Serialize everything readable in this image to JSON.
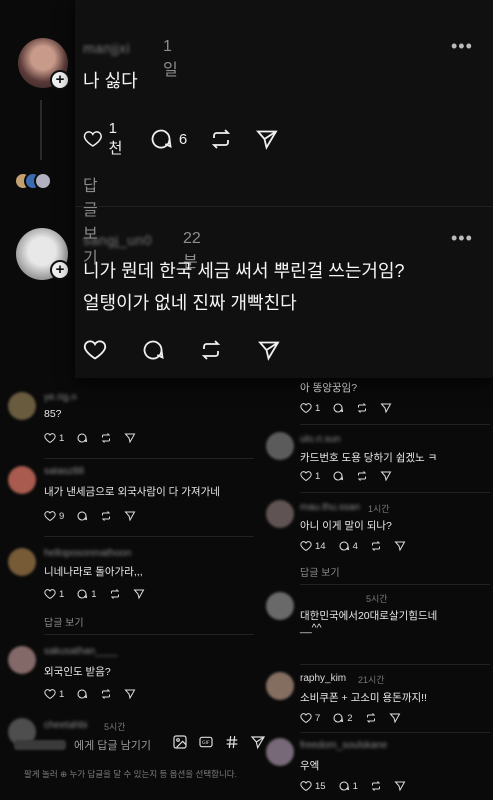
{
  "main_card": {
    "post1": {
      "username": "manjjxi",
      "time": "1일",
      "more": "•••",
      "text": "나 싫다",
      "likes": "1천",
      "comments": "6",
      "view_replies": "답글 보기"
    },
    "post2": {
      "username": "sangj_un0",
      "time": "22분",
      "more": "•••",
      "line1": "니가 뭔데 한국 세금 써서 뿌린걸 쓰는거임?",
      "line2": "얼탱이가 없네 진짜 개빡친다"
    }
  },
  "left_feed": [
    {
      "username": "ye.rig.n",
      "time": "",
      "text": "85?",
      "likes": "1",
      "comments": ""
    },
    {
      "username": "satasz88",
      "time": "",
      "text": "내가 낸세금으로 외국사람이 다 가져가네",
      "likes": "9",
      "comments": ""
    },
    {
      "username": "helloposonmathoon",
      "time": "",
      "text": "니네나라로 돌아가라,,,",
      "likes": "1",
      "comments": "1",
      "replies": "답글 보기"
    },
    {
      "username": "sakusathan____",
      "time": "",
      "text": "외국인도 받음?",
      "likes": "1",
      "comments": ""
    },
    {
      "username": "cheetahbi",
      "time": "5시간",
      "text": "",
      "likes": "",
      "comments": ""
    }
  ],
  "right_feed": [
    {
      "username": "",
      "time": "",
      "text": "아 똥양꿍임?",
      "likes": "1",
      "comments": ""
    },
    {
      "username": "ulo.ri.sun",
      "time": "",
      "text": "카드번호 도용 당하기 쉽겠노 ㅋ",
      "likes": "1",
      "comments": ""
    },
    {
      "username": "mau.thu.ssan",
      "time": "1시간",
      "text": "아니 이게 말이 되나?",
      "likes": "14",
      "comments": "4",
      "replies": "답글 보기"
    },
    {
      "username": "",
      "time": "5시간",
      "text": "대한민국에서20대로살기힘드네",
      "text2": "__^^",
      "likes": "",
      "comments": ""
    },
    {
      "username": "raphy_kim",
      "time": "21시간",
      "text": "소비쿠폰 + 고소미 용돈까지!!",
      "likes": "7",
      "comments": "2"
    },
    {
      "username": "freedom_soulskane",
      "time": "",
      "text": "우엑",
      "likes": "15",
      "comments": "1"
    }
  ],
  "reply_bar": {
    "placeholder": "에게 답글 남기기"
  },
  "notice": "팔게 놀러 ⊕ 누가 답글을 달 수 있는지 등 옵션을 선택합니다.",
  "colors": {
    "background": "#0a0a0a",
    "card": "#101010",
    "text": "#f5f5f5",
    "muted": "#8a8a8a"
  }
}
